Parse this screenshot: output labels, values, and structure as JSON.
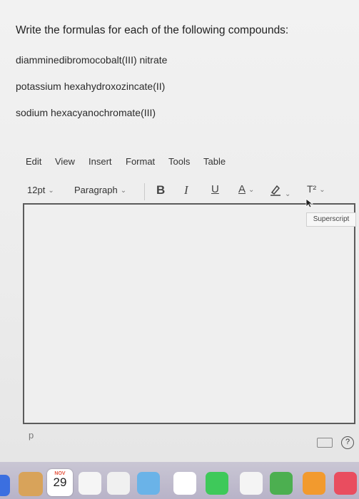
{
  "question": "Write the formulas for each of the following compounds:",
  "compounds": [
    "diamminedibromocobalt(III) nitrate",
    "potassium hexahydroxozincate(II)",
    "sodium hexacyanochromate(III)"
  ],
  "menu": [
    "Edit",
    "View",
    "Insert",
    "Format",
    "Tools",
    "Table"
  ],
  "toolbar": {
    "font_size": "12pt",
    "block_format": "Paragraph",
    "bold": "B",
    "italic": "I",
    "underline": "U",
    "text_color": "A",
    "superscript": "T²"
  },
  "tooltip": "Superscript",
  "status_path": "p",
  "help": "?",
  "calendar": {
    "month": "NOV",
    "day": "29"
  },
  "icons": {
    "menu_chevron": "chevron-down-icon",
    "highlight": "highlighter-icon",
    "keyboard": "keyboard-icon",
    "help": "help-icon"
  },
  "colors": {
    "editor_border": "#5b5b5b",
    "dock": "#bdb8cc"
  }
}
